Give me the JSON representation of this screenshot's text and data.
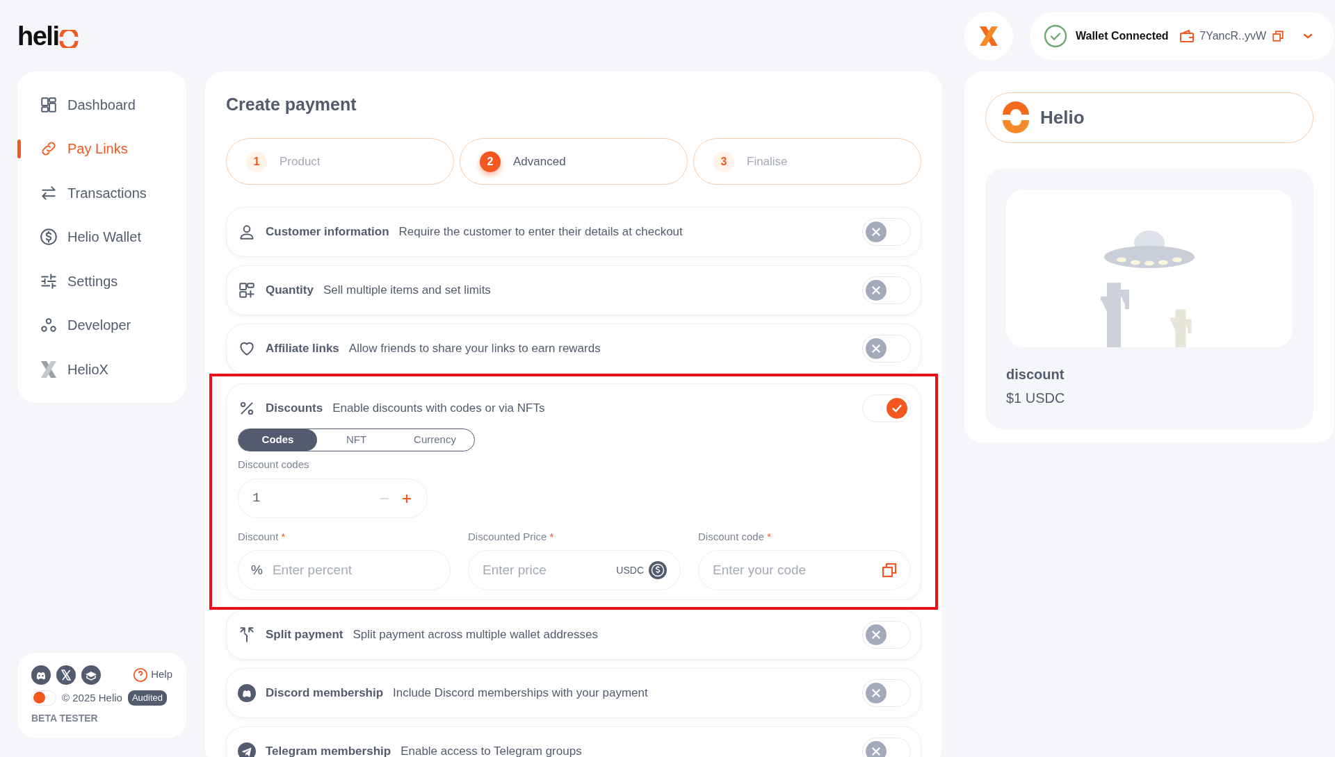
{
  "logo": "heli",
  "header": {
    "wallet_status": "Wallet Connected",
    "address": "7YancR..yvW"
  },
  "sidebar": {
    "items": [
      {
        "label": "Dashboard",
        "selected": false
      },
      {
        "label": "Pay Links",
        "selected": true
      },
      {
        "label": "Transactions",
        "selected": false
      },
      {
        "label": "Helio Wallet",
        "selected": false
      },
      {
        "label": "Settings",
        "selected": false
      },
      {
        "label": "Developer",
        "selected": false
      },
      {
        "label": "HelioX",
        "selected": false
      }
    ]
  },
  "footer": {
    "help": "Help",
    "copyright": "© 2025 Helio",
    "badge": "Audited",
    "role": "BETA TESTER",
    "theme_toggle_on": false
  },
  "main": {
    "title": "Create payment",
    "steps": [
      {
        "number": "1",
        "label": "Product",
        "selected": false
      },
      {
        "number": "2",
        "label": "Advanced",
        "selected": true
      },
      {
        "number": "3",
        "label": "Finalise",
        "selected": false
      }
    ],
    "options": [
      {
        "title": "Customer information",
        "description": "Require the customer to enter their details at checkout",
        "on": false,
        "highlighted": false
      },
      {
        "title": "Quantity",
        "description": "Sell multiple items and set limits",
        "on": false,
        "highlighted": false
      },
      {
        "title": "Affiliate links",
        "description": "Allow friends to share your links to earn rewards",
        "on": false,
        "highlighted": false
      },
      {
        "title": "Discounts",
        "description": "Enable discounts with codes or via NFTs",
        "on": true,
        "highlighted": true,
        "details": {
          "tabs": [
            {
              "label": "Codes",
              "selected": true
            },
            {
              "label": "NFT",
              "selected": false
            },
            {
              "label": "Currency",
              "selected": false
            }
          ],
          "codes_label": "Discount codes",
          "codes_value": "1",
          "minus_disabled": true,
          "fields": [
            {
              "kind": "percent",
              "label": "Discount",
              "required_mark": "*",
              "prefix": "%",
              "placeholder": "Enter percent"
            },
            {
              "kind": "price",
              "label": "Discounted Price",
              "required_mark": "*",
              "placeholder": "Enter price",
              "suffix": "USDC"
            },
            {
              "kind": "code",
              "label": "Discount code",
              "required_mark": "*",
              "placeholder": "Enter your code"
            }
          ]
        }
      },
      {
        "title": "Split payment",
        "description": "Split payment across multiple wallet addresses",
        "on": false,
        "highlighted": false
      },
      {
        "title": "Discord membership",
        "description": "Include Discord memberships with your payment",
        "on": false,
        "highlighted": false
      },
      {
        "title": "Telegram membership",
        "description": "Enable access to Telegram groups",
        "on": false,
        "highlighted": false
      }
    ]
  },
  "preview": {
    "brand": "Helio",
    "product_name": "discount",
    "price": "$1 USDC"
  }
}
